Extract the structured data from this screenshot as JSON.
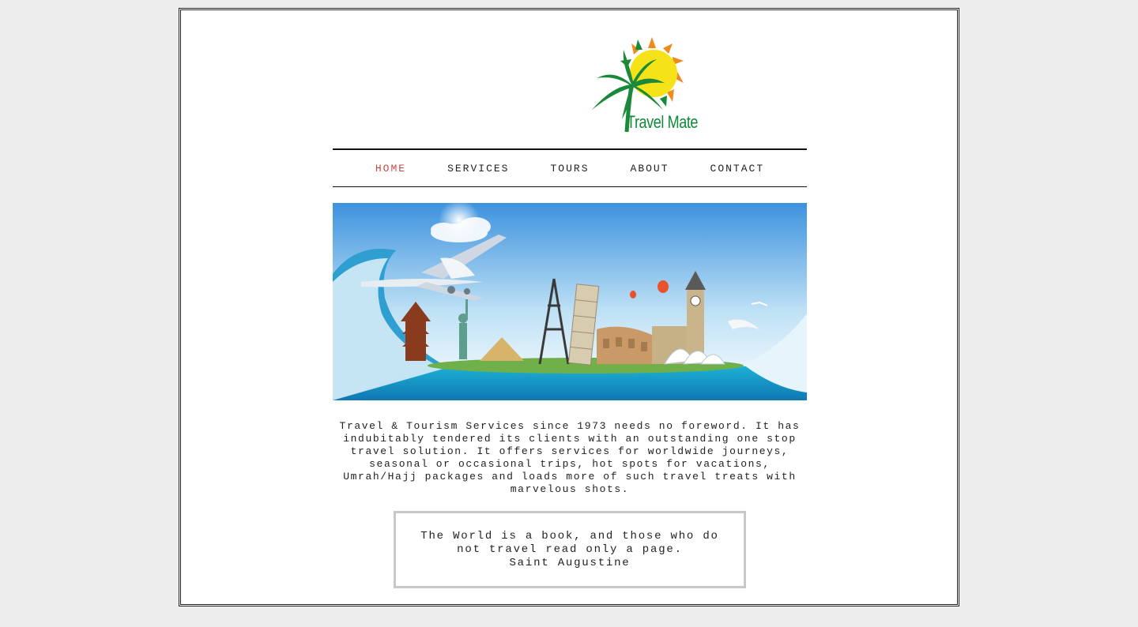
{
  "logo": {
    "text": "Travel Mate",
    "colors": {
      "sun": "#f5e218",
      "rays": "#ef8a1c",
      "palm": "#1a8a3a"
    }
  },
  "nav": {
    "items": [
      {
        "label": "HOME",
        "active": true
      },
      {
        "label": "SERVICES",
        "active": false
      },
      {
        "label": "TOURS",
        "active": false
      },
      {
        "label": "ABOUT",
        "active": false
      },
      {
        "label": "CONTACT",
        "active": false
      }
    ],
    "active_color": "#c44a4a"
  },
  "intro": {
    "text": "Travel & Tourism Services since 1973 needs no foreword. It has indubitably tendered its clients with an outstanding one stop travel solution. It offers services for worldwide journeys, seasonal or occasional trips, hot spots for vacations, Umrah/Hajj packages and loads more of such travel treats with marvelous shots."
  },
  "quote": {
    "text": "The World is a book, and those who do not travel read only a page.",
    "author": "Saint Augustine"
  }
}
